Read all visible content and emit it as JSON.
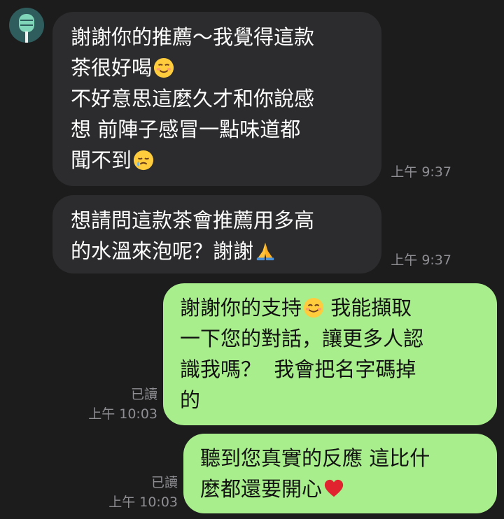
{
  "messages": [
    {
      "side": "incoming",
      "text": "謝謝你的推薦～我覺得這款\n茶很好喝",
      "emoji1": "relieved-smile-emoji",
      "text2": "\n不好意思這麼久才和你說感\n想 前陣子感冒一點味道都\n聞不到",
      "emoji2": "crying-smile-emoji",
      "time": "上午 9:37"
    },
    {
      "side": "incoming",
      "text": "想請問這款茶會推薦用多高\n的水溫來泡呢？謝謝",
      "emoji1": "folded-hands-emoji",
      "time": "上午 9:37"
    },
    {
      "side": "outgoing",
      "text": "謝謝你的支持",
      "emoji1": "smiling-face-emoji",
      "text2": " 我能擷取\n一下您的對話，讓更多人認\n識我嗎？  我會把名字碼掉\n的",
      "read": "已讀",
      "time": "上午 10:03"
    },
    {
      "side": "outgoing",
      "text": "聽到您真實的反應 這比什\n麼都還要開心",
      "emoji1": "red-heart-emoji",
      "read": "已讀",
      "time": "上午 10:03"
    }
  ],
  "colors": {
    "background": "#1c1c1d",
    "incoming_bubble": "#2c2c2e",
    "outgoing_bubble": "#a8ee8c",
    "meta_text": "#8e8e93"
  }
}
